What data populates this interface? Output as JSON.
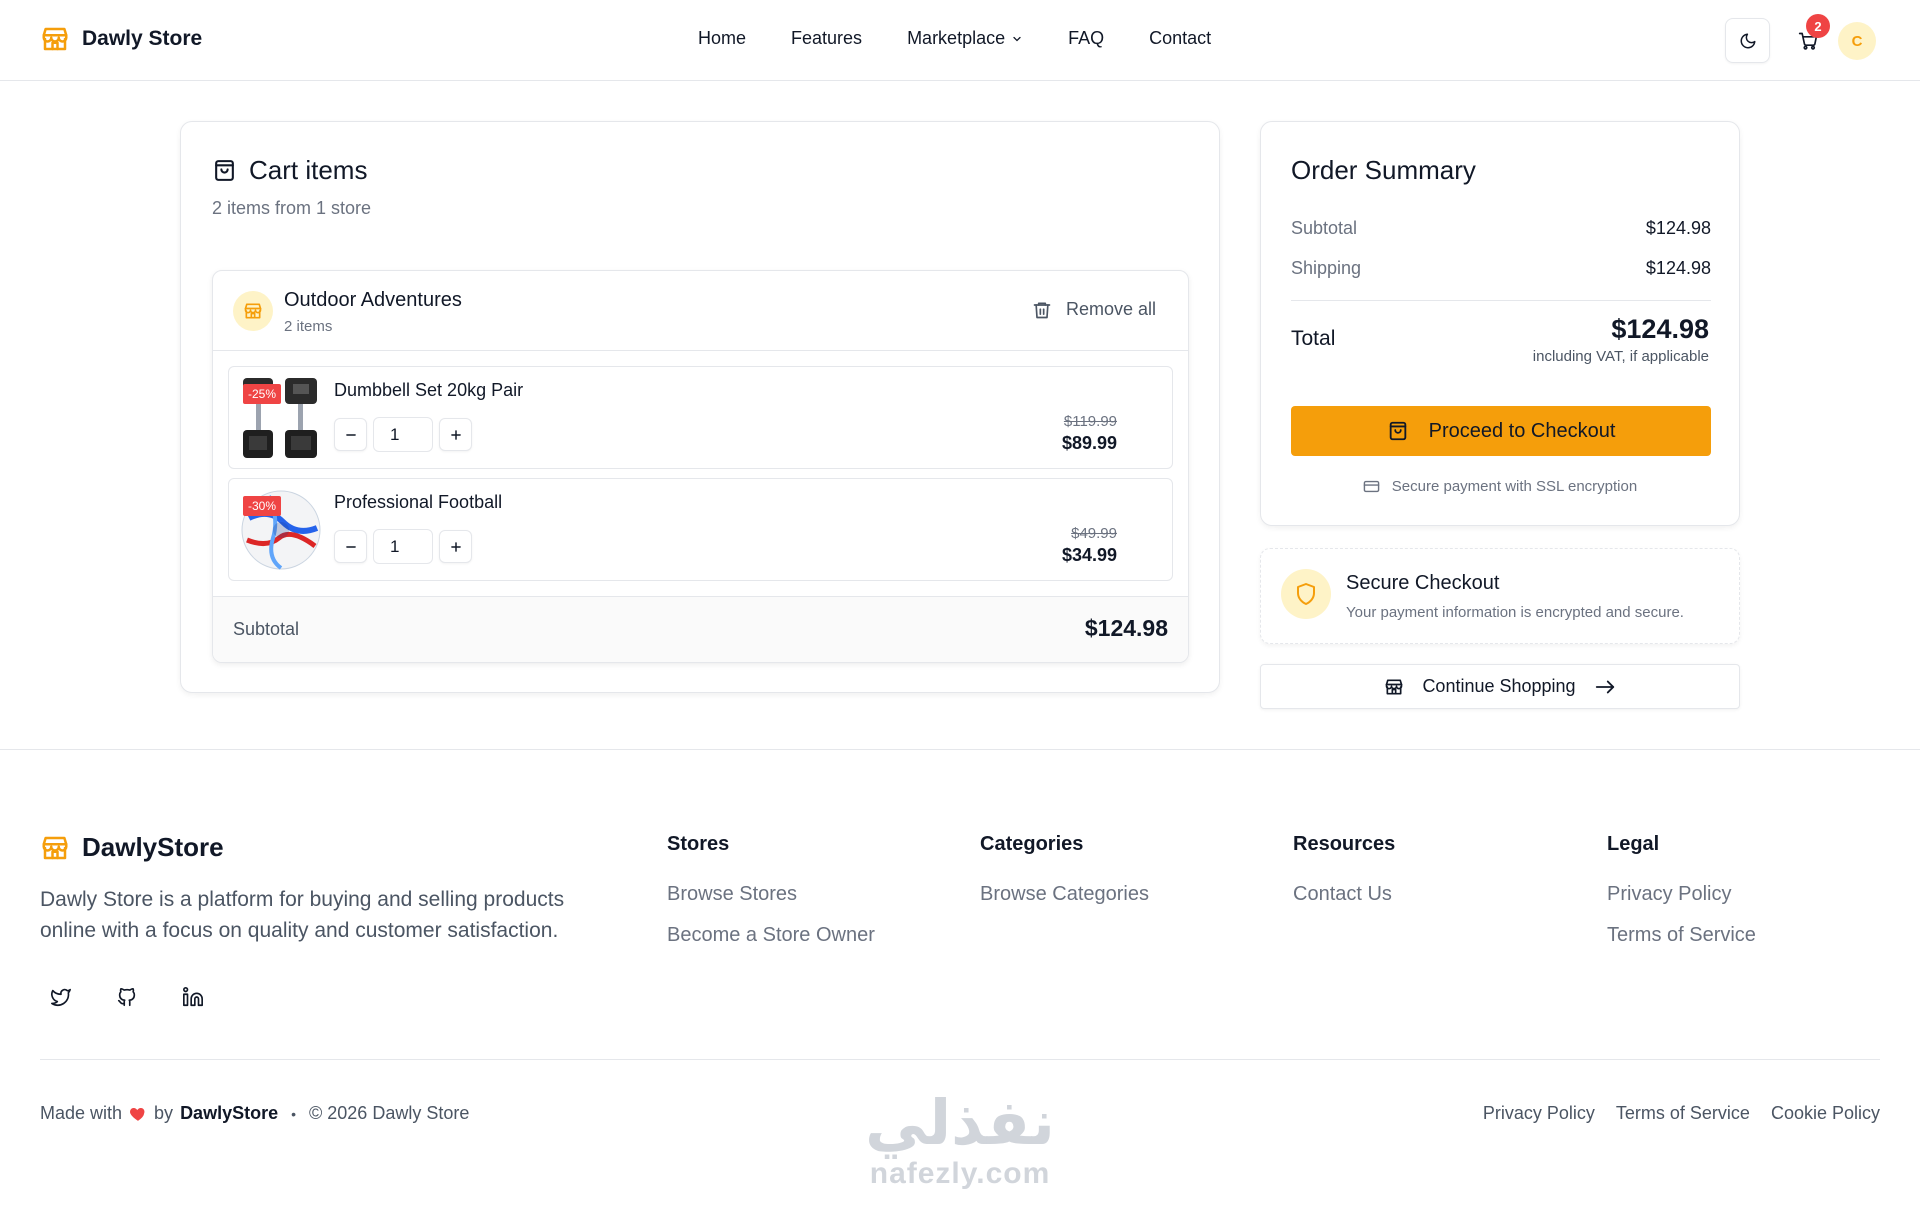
{
  "header": {
    "brand": "Dawly Store",
    "nav": [
      "Home",
      "Features",
      "Marketplace",
      "FAQ",
      "Contact"
    ],
    "cart_count": "2",
    "avatar_initial": "C"
  },
  "cart": {
    "title": "Cart items",
    "subtitle": "2 items from 1 store",
    "store": {
      "name": "Outdoor Adventures",
      "count": "2 items",
      "remove_all": "Remove all",
      "items": [
        {
          "name": "Dumbbell Set 20kg Pair",
          "discount": "-25%",
          "qty": "1",
          "old_price": "$119.99",
          "price": "$89.99"
        },
        {
          "name": "Professional Football",
          "discount": "-30%",
          "qty": "1",
          "old_price": "$49.99",
          "price": "$34.99"
        }
      ],
      "subtotal_label": "Subtotal",
      "subtotal_value": "$124.98"
    }
  },
  "summary": {
    "title": "Order Summary",
    "subtotal_label": "Subtotal",
    "subtotal_value": "$124.98",
    "shipping_label": "Shipping",
    "shipping_value": "$124.98",
    "total_label": "Total",
    "total_value": "$124.98",
    "total_note": "including VAT, if applicable",
    "checkout_label": "Proceed to Checkout",
    "secure_note": "Secure payment with SSL encryption"
  },
  "secure_box": {
    "title": "Secure Checkout",
    "text": "Your payment information is encrypted and secure."
  },
  "continue_label": "Continue Shopping",
  "footer": {
    "brand": "DawlyStore",
    "description": "Dawly Store is a platform for buying and selling products online with a focus on quality and customer satisfaction.",
    "columns": [
      {
        "title": "Stores",
        "links": [
          "Browse Stores",
          "Become a Store Owner"
        ]
      },
      {
        "title": "Categories",
        "links": [
          "Browse Categories"
        ]
      },
      {
        "title": "Resources",
        "links": [
          "Contact Us"
        ]
      },
      {
        "title": "Legal",
        "links": [
          "Privacy Policy",
          "Terms of Service"
        ]
      }
    ],
    "made_with": "Made with",
    "by": "by",
    "made_brand": "DawlyStore",
    "copyright": "© 2026 Dawly Store",
    "bottom_links": [
      "Privacy Policy",
      "Terms of Service",
      "Cookie Policy"
    ]
  },
  "watermark": {
    "arabic": "نفذلي",
    "latin": "nafezly.com"
  },
  "colors": {
    "accent": "#f59e0b",
    "accent_soft": "#fef3c7",
    "danger": "#ef4444"
  }
}
